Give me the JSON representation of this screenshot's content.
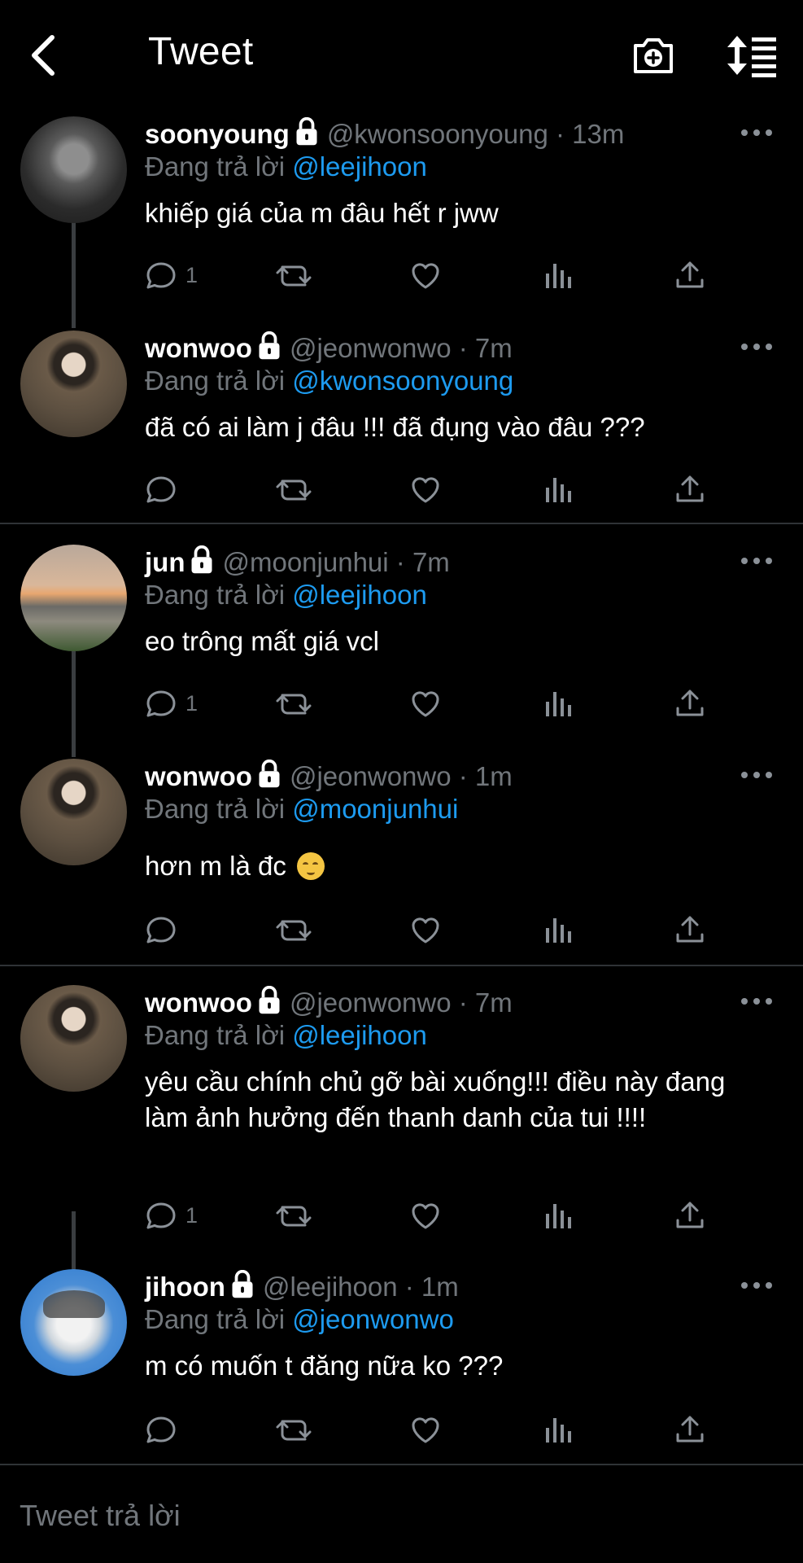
{
  "header": {
    "title": "Tweet",
    "back_icon": "chevron-left-icon",
    "camera_icon": "camera-plus-icon",
    "sort_icon": "sort-lines-icon"
  },
  "colors": {
    "background": "#000000",
    "text": "#ffffff",
    "secondary": "#71767b",
    "mention": "#1d9bf0",
    "divider": "#2f3336"
  },
  "tweets": [
    {
      "name": "soonyoung",
      "handle": "@kwonsoonyoung",
      "time": "· 13m",
      "replying_prefix": "Đang trả lời",
      "mention": "@leejihoon",
      "text": "khiếp giá của m đâu hết r jww",
      "reply_count": "1"
    },
    {
      "name": "wonwoo",
      "handle": "@jeonwonwo",
      "time": "· 7m",
      "replying_prefix": "Đang trả lời",
      "mention": "@kwonsoonyoung",
      "text": "đã có ai làm j đâu !!! đã đụng vào đâu ???",
      "reply_count": ""
    },
    {
      "name": "jun",
      "handle": "@moonjunhui",
      "time": "· 7m",
      "replying_prefix": "Đang trả lời",
      "mention": "@leejihoon",
      "text": "eo trông mất giá vcl",
      "reply_count": "1"
    },
    {
      "name": "wonwoo",
      "handle": "@jeonwonwo",
      "time": "· 1m",
      "replying_prefix": "Đang trả lời",
      "mention": "@moonjunhui",
      "text": "hơn m là đc",
      "reply_count": ""
    },
    {
      "name": "wonwoo",
      "handle": "@jeonwonwo",
      "time": "· 7m",
      "replying_prefix": "Đang trả lời",
      "mention": "@leejihoon",
      "text": "yêu cầu chính chủ gỡ bài xuống!!! điều này đang làm ảnh hưởng đến thanh danh của tui !!!!",
      "reply_count": "1"
    },
    {
      "name": "jihoon",
      "handle": "@leejihoon",
      "time": "· 1m",
      "replying_prefix": "Đang trả lời",
      "mention": "@jeonwonwo",
      "text": "m có muốn t đăng nữa ko ???",
      "reply_count": ""
    }
  ],
  "reply": {
    "placeholder": "Tweet trả lời"
  }
}
